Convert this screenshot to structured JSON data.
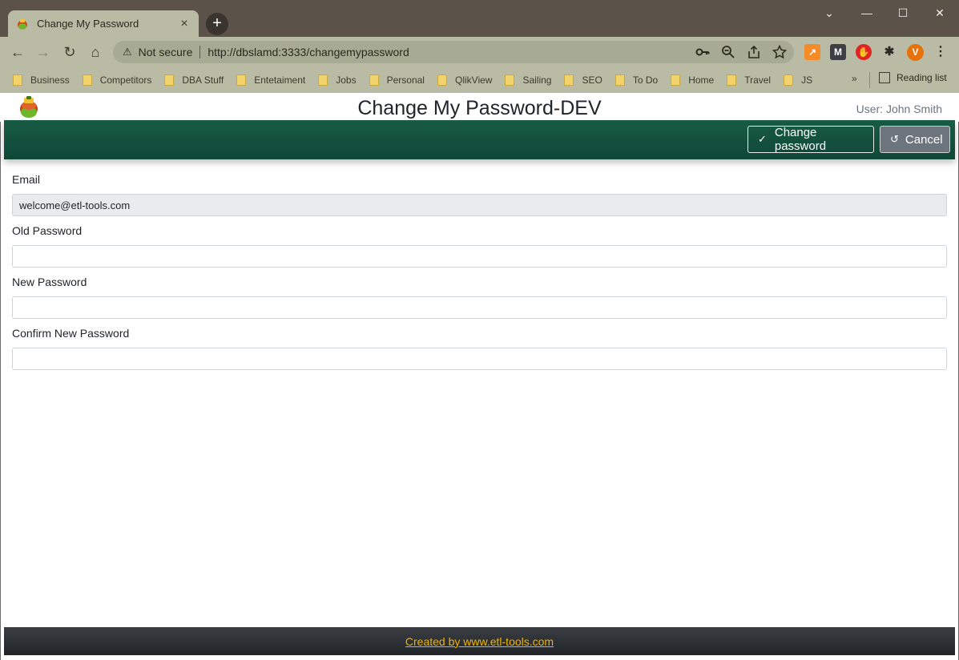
{
  "browser": {
    "tab_title": "Change My Password",
    "tab_close": "×",
    "new_tab": "+",
    "window_controls": {
      "menu": "⌄",
      "minimize": "—",
      "maximize": "☐",
      "close": "✕"
    },
    "nav": {
      "back": "←",
      "forward": "→",
      "reload": "↻",
      "home": "⌂"
    },
    "address": {
      "warning_icon": "⚠",
      "security_label": "Not secure",
      "url": "http://dbslamd:3333/changemypassword"
    },
    "omnibox_icons": [
      "key-icon",
      "zoom-icon",
      "share-icon",
      "star-icon"
    ],
    "extensions": [
      {
        "name": "analytics-extension-icon",
        "color": "#f28b28",
        "glyph": "↗"
      },
      {
        "name": "m-extension-icon",
        "color": "#3d3f44",
        "glyph": "M"
      },
      {
        "name": "stop-extension-icon",
        "color": "#e02424",
        "glyph": "✋"
      },
      {
        "name": "puzzle-extension-icon",
        "color": "#b9bba4",
        "glyph": "✱"
      },
      {
        "name": "profile-avatar-icon",
        "color": "#e8710a",
        "glyph": "V"
      }
    ],
    "menu_icon": "⋮",
    "bookmarks": [
      "Business",
      "Competitors",
      "DBA Stuff",
      "Entetaiment",
      "Jobs",
      "Personal",
      "QlikView",
      "Sailing",
      "SEO",
      "To Do",
      "Home",
      "Travel",
      "JS"
    ],
    "bookmarks_more": "»",
    "reading_list": "Reading list"
  },
  "page": {
    "title": "Change My Password-DEV",
    "user": "User: John Smith",
    "actions": {
      "change_password": "Change password",
      "cancel": "Cancel"
    },
    "form": {
      "email_label": "Email",
      "email_value": "welcome@etl-tools.com",
      "old_password_label": "Old Password",
      "new_password_label": "New Password",
      "confirm_password_label": "Confirm New Password"
    },
    "footer_link": "Created by www.etl-tools.com"
  }
}
